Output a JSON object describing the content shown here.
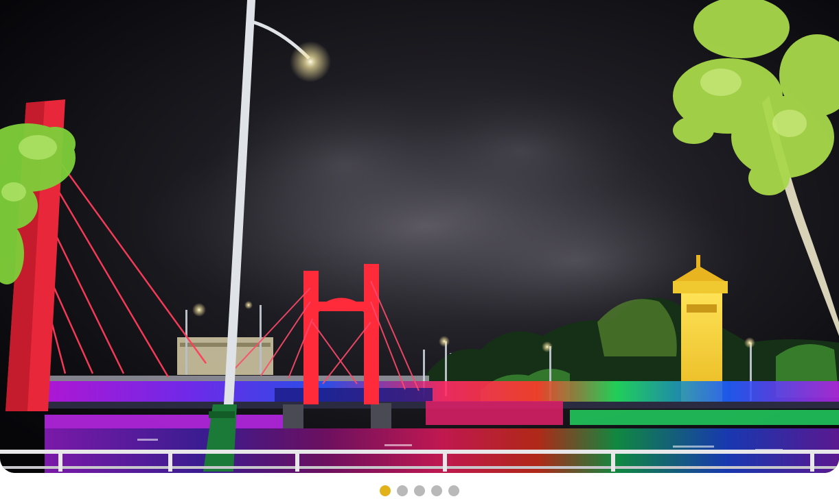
{
  "carousel": {
    "slide_count": 5,
    "active_index": 0,
    "colors": {
      "active_dot": "#e2b21a",
      "inactive_dot": "#b9b9b9"
    }
  },
  "photo": {
    "icon": "night-scene-photo"
  }
}
